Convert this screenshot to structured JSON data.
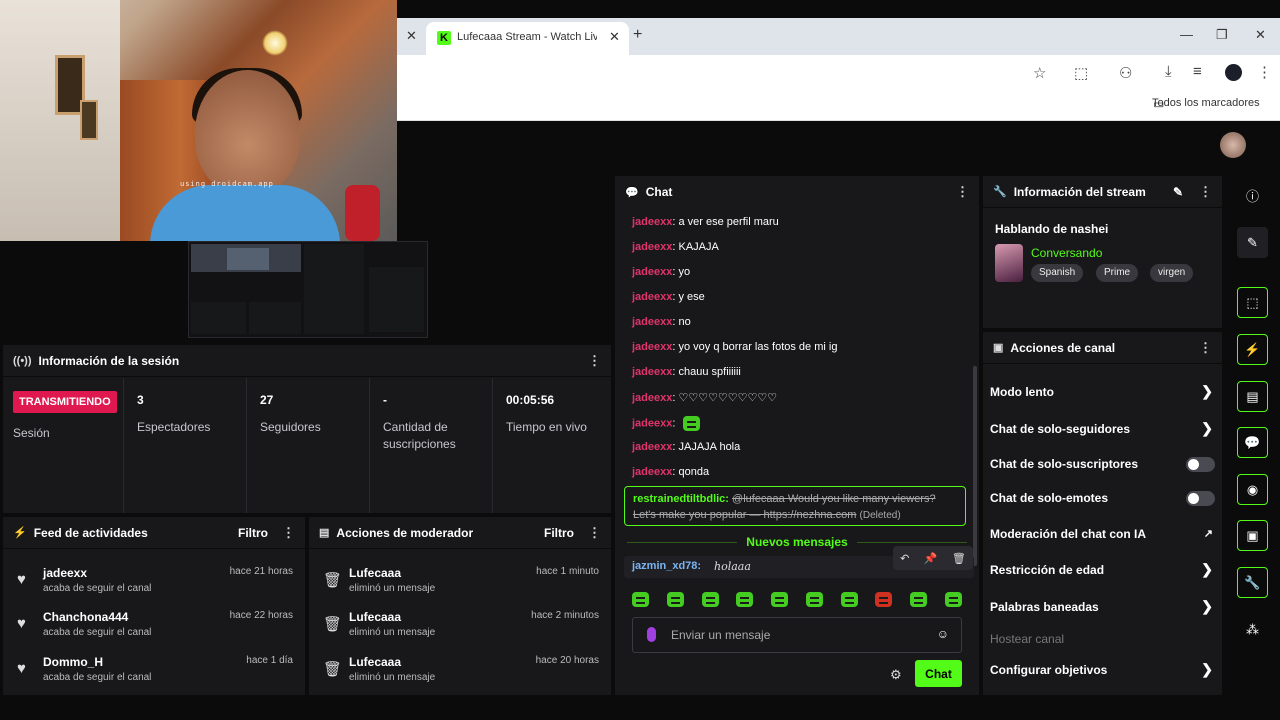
{
  "browser": {
    "tab_title": "Lufecaaa Stream - Watch Live on",
    "all_bookmarks": "Todos los marcadores"
  },
  "webcam": {
    "overlay_text": "using droidcam.app"
  },
  "session": {
    "title": "Información de la sesión",
    "live_badge": "TRANSMITIENDO",
    "session_label": "Sesión",
    "stats": [
      {
        "value": "3",
        "label": "Espectadores"
      },
      {
        "value": "27",
        "label": "Seguidores"
      },
      {
        "value": "-",
        "label": "Cantidad de suscripciones"
      },
      {
        "value": "00:05:56",
        "label": "Tiempo en vivo"
      }
    ]
  },
  "feed": {
    "title": "Feed de actividades",
    "filter": "Filtro",
    "items": [
      {
        "name": "jadeexx",
        "desc": "acaba de seguir el canal",
        "time": "hace 21 horas"
      },
      {
        "name": "Chanchona444",
        "desc": "acaba de seguir el canal",
        "time": "hace 22 horas"
      },
      {
        "name": "Dommo_H",
        "desc": "acaba de seguir el canal",
        "time": "hace 1 día"
      }
    ]
  },
  "mod": {
    "title": "Acciones de moderador",
    "filter": "Filtro",
    "items": [
      {
        "name": "Lufecaaa",
        "desc": "eliminó un mensaje",
        "time": "hace 1 minuto"
      },
      {
        "name": "Lufecaaa",
        "desc": "eliminó un mensaje",
        "time": "hace 2 minutos"
      },
      {
        "name": "Lufecaaa",
        "desc": "eliminó un mensaje",
        "time": "hace 20 horas"
      }
    ]
  },
  "chat": {
    "title": "Chat",
    "messages": [
      {
        "user": "jadeexx",
        "text": ": a ver ese perfil maru"
      },
      {
        "user": "jadeexx",
        "text": ": KAJAJA"
      },
      {
        "user": "jadeexx",
        "text": ": yo"
      },
      {
        "user": "jadeexx",
        "text": ": y ese"
      },
      {
        "user": "jadeexx",
        "text": ": no"
      },
      {
        "user": "jadeexx",
        "text": ": yo voy q borrar las fotos de mi ig"
      },
      {
        "user": "jadeexx",
        "text": ": chauu spfiiiiii"
      },
      {
        "user": "jadeexx",
        "text": ": ♡♡♡♡♡♡♡♡♡♡"
      },
      {
        "user": "jadeexx",
        "text": ":"
      },
      {
        "user": "jadeexx",
        "text": ": JAJAJA hola"
      },
      {
        "user": "jadeexx",
        "text": ": qonda"
      }
    ],
    "deleted": {
      "user": "restrainedtiltbdlic:",
      "line1": "@lufecaaa Would you like many viewers?",
      "line2": "Let's make you popular — https://nezhna.com",
      "tag": "(Deleted)"
    },
    "new_messages": "Nuevos mensajes",
    "last": {
      "user": "jazmin_xd78:",
      "text": "holaaa"
    },
    "input_placeholder": "Enviar un mensaje",
    "send_button": "Chat"
  },
  "stream_info": {
    "title": "Información del stream",
    "stream_title": "Hablando de nashei",
    "category": "Conversando",
    "tags": [
      "Spanish",
      "Prime",
      "virgen"
    ]
  },
  "channel_actions": {
    "title": "Acciones de canal",
    "items": [
      {
        "label": "Modo lento",
        "kind": "arrow"
      },
      {
        "label": "Chat de solo-seguidores",
        "kind": "arrow"
      },
      {
        "label": "Chat de solo-suscriptores",
        "kind": "toggle"
      },
      {
        "label": "Chat de solo-emotes",
        "kind": "toggle"
      },
      {
        "label": "Moderación del chat con IA",
        "kind": "external"
      },
      {
        "label": "Restricción de edad",
        "kind": "arrow"
      },
      {
        "label": "Palabras baneadas",
        "kind": "arrow"
      },
      {
        "label": "Hostear canal",
        "kind": "disabled"
      },
      {
        "label": "Configurar objetivos",
        "kind": "arrow"
      }
    ]
  },
  "colors": {
    "accent": "#53fc18",
    "live": "#e01850",
    "chat_user": "#e0346a",
    "panel": "#18181b"
  }
}
